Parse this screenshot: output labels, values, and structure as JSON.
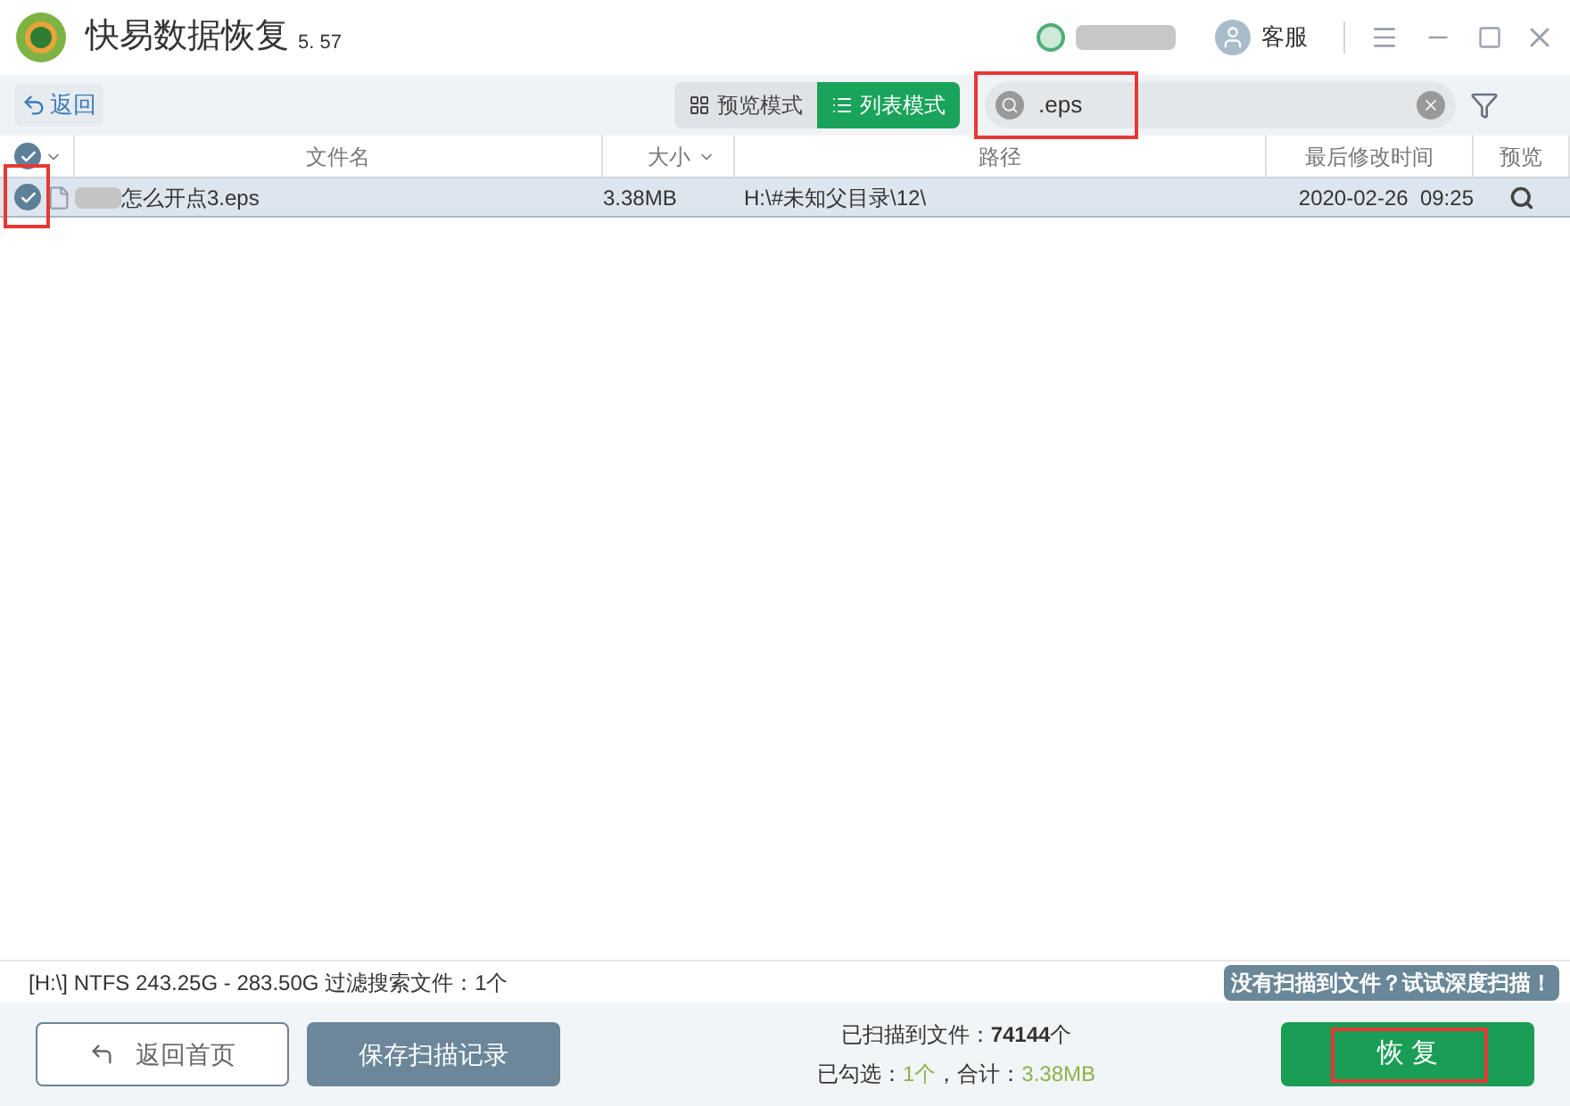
{
  "window": {
    "title": "快易数据恢复",
    "version": "5. 57",
    "support": "客服"
  },
  "toolbar": {
    "back": "返回",
    "modes": [
      {
        "label": "预览模式",
        "kind": "grid",
        "selected": false
      },
      {
        "label": "列表模式",
        "kind": "list",
        "selected": true
      }
    ],
    "search": {
      "value": ".eps",
      "highlighted": true
    }
  },
  "table": {
    "all_checked": true,
    "columns": [
      {
        "label": "文件名",
        "sortable": false
      },
      {
        "label": "大小",
        "sortable": true
      },
      {
        "label": "路径",
        "sortable": false
      },
      {
        "label": "最后修改时间",
        "sortable": false
      },
      {
        "label": "预览",
        "sortable": false
      }
    ],
    "rows": [
      {
        "checked": true,
        "check_highlighted": true,
        "selected": true,
        "name": "怎么开点3.eps",
        "size": "3.38MB",
        "path": "H:\\#未知父目录\\12\\",
        "modified": "2020-02-26  09:25"
      }
    ]
  },
  "status_bar": {
    "text": "[H:\\] NTFS 243.25G - 283.50G 过滤搜索文件：1个",
    "deep_scan": "没有扫描到文件？试试深度扫描！"
  },
  "footer": {
    "home": "返回首页",
    "save": "保存扫描记录",
    "scanned": [
      {
        "text": "已扫描到文件：",
        "kind": "plain"
      },
      {
        "text": "74144",
        "kind": "strong"
      },
      {
        "text": "个",
        "kind": "plain"
      }
    ],
    "checked": [
      {
        "text": "已勾选：",
        "kind": "plain"
      },
      {
        "text": "1个",
        "kind": "accent"
      },
      {
        "text": "，合计：",
        "kind": "plain"
      },
      {
        "text": "3.38MB",
        "kind": "accent"
      }
    ],
    "recover": {
      "label": "恢 复",
      "highlighted": true
    }
  }
}
